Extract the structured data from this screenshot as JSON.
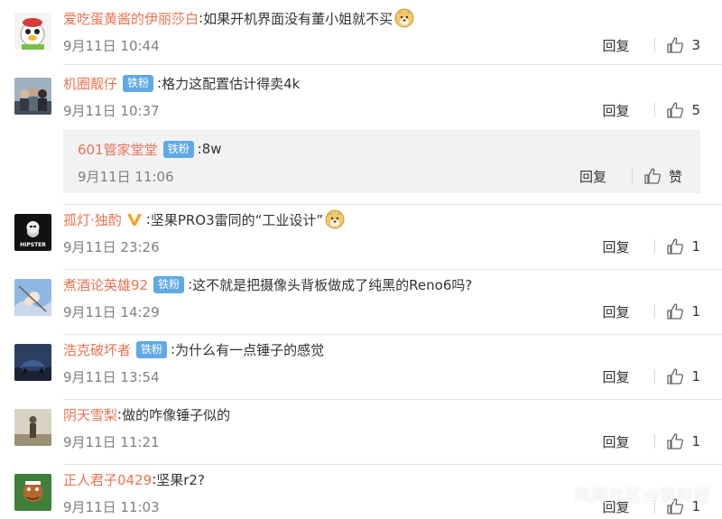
{
  "comments": [
    {
      "user": "爱吃蛋黄酱的伊丽莎白",
      "badge": "",
      "text": "如果开机界面没有董小姐就不买",
      "emoji": "doge-icon",
      "time": "9月11日 10:44",
      "reply": "回复",
      "likes": "3"
    },
    {
      "user": "机圈靓仔",
      "badge": "铁粉",
      "text": "格力这配置估计得卖4k",
      "emoji": "",
      "time": "9月11日 10:37",
      "reply": "回复",
      "likes": "5"
    },
    {
      "user": "孤灯·独酌",
      "badge": "",
      "text": "坚果PRO3雷同的“工业设计”",
      "emoji": "doge-icon",
      "time": "9月11日 23:26",
      "reply": "回复",
      "likes": "1",
      "avatar_text": "HIPSTER"
    },
    {
      "user": "煮酒论英雄92",
      "badge": "铁粉",
      "text": "这不就是把摄像头背板做成了纯黑的Reno6吗?",
      "emoji": "",
      "time": "9月11日 14:29",
      "reply": "回复",
      "likes": "1"
    },
    {
      "user": "浩克破坏者",
      "badge": "铁粉",
      "text": "为什么有一点锤子的感觉",
      "emoji": "",
      "time": "9月11日 13:54",
      "reply": "回复",
      "likes": "1"
    },
    {
      "user": "阴天雪梨",
      "badge": "",
      "text": "做的咋像锤子似的",
      "emoji": "",
      "time": "9月11日 11:21",
      "reply": "回复",
      "likes": "1"
    },
    {
      "user": "正人君子0429",
      "badge": "",
      "text": "坚果r2?",
      "emoji": "",
      "time": "9月11日 11:03",
      "reply": "回复",
      "likes": "1"
    }
  ],
  "sub_reply": {
    "user": "601管家堂堂",
    "badge": "铁粉",
    "text": "8w",
    "time": "9月11日 11:06",
    "reply": "回复",
    "like_label": "赞"
  },
  "colon": ":",
  "watermark": "风闻社区@紫财经",
  "colors": {
    "username": "#eb7350",
    "badge": "#5fa9e6",
    "time": "#808080",
    "sub_bg": "#f2f2f5",
    "vip": "#f6a623"
  }
}
